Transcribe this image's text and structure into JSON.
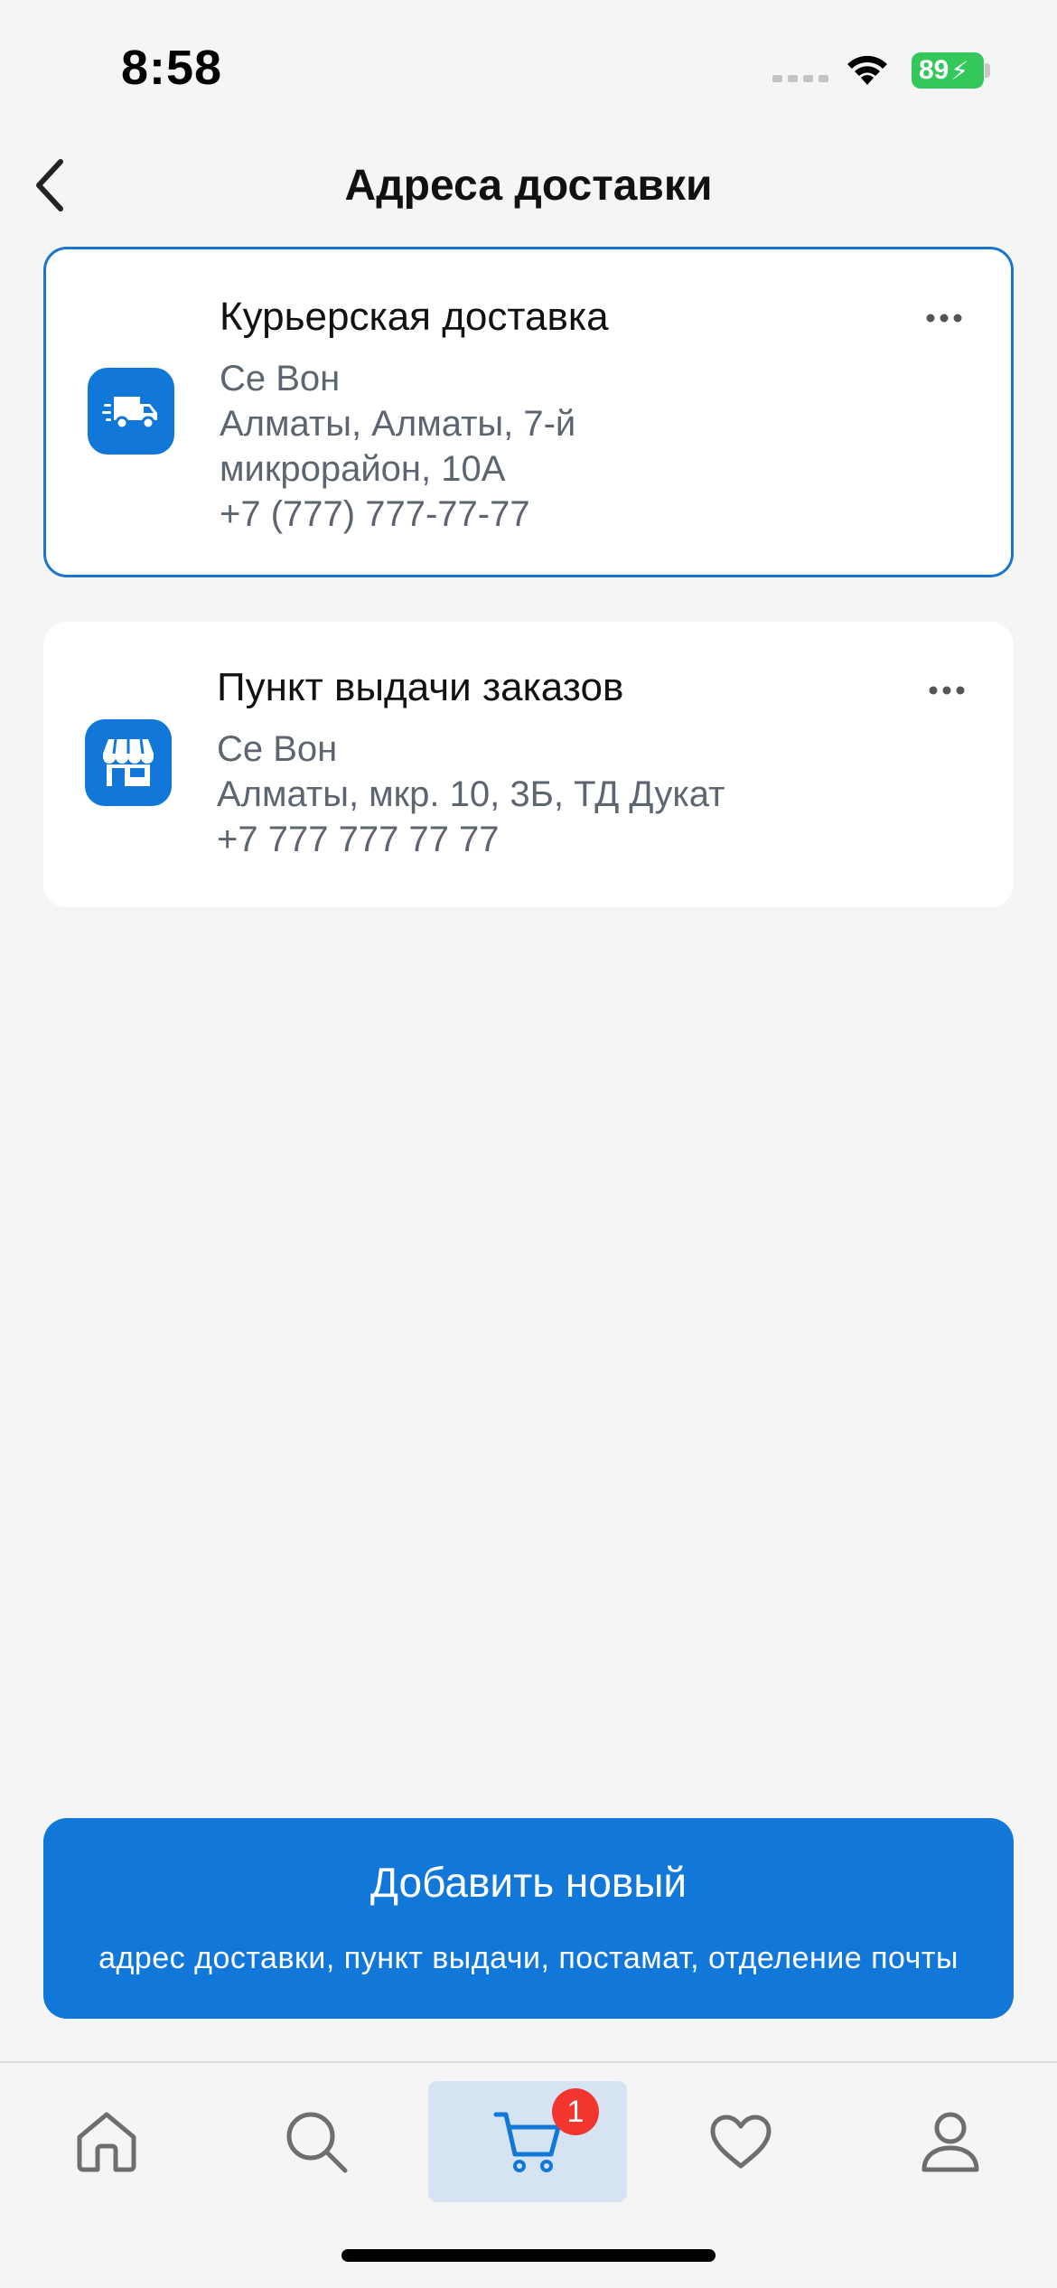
{
  "status_bar": {
    "time": "8:58",
    "battery": "89"
  },
  "header": {
    "title": "Адреса доставки"
  },
  "addresses": [
    {
      "title": "Курьерская доставка",
      "lines": [
        "Се Вон",
        "Алматы, Алматы, 7-й",
        "микрорайон, 10А",
        "+7 (777) 777-77-77"
      ],
      "icon": "delivery-truck-icon",
      "selected": true
    },
    {
      "title": "Пункт выдачи заказов",
      "lines": [
        "Се Вон",
        "Алматы, мкр. 10, 3Б, ТД Дукат",
        "+7 777 777 77 77"
      ],
      "icon": "storefront-icon",
      "selected": false
    }
  ],
  "add_button": {
    "title": "Добавить новый",
    "subtitle": "адрес доставки, пункт выдачи, постамат, отделение почты"
  },
  "tab_bar": {
    "items": [
      {
        "icon": "home-icon"
      },
      {
        "icon": "search-icon"
      },
      {
        "icon": "cart-icon",
        "active": true,
        "badge": "1"
      },
      {
        "icon": "heart-icon"
      },
      {
        "icon": "profile-icon"
      }
    ]
  },
  "colors": {
    "accent": "#1177d9",
    "badge": "#f2352f",
    "battery": "#34c759",
    "secondary_text": "#5d6570"
  }
}
